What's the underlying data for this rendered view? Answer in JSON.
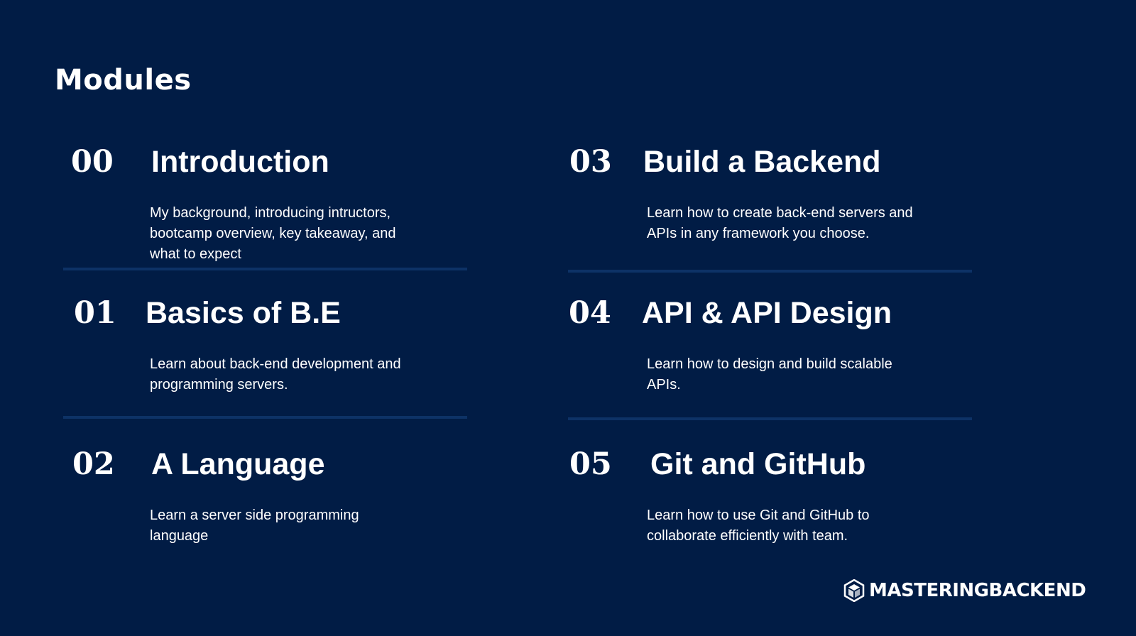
{
  "page": {
    "title": "Modules"
  },
  "modules": [
    {
      "number": "00",
      "title": "Introduction",
      "description": "My background, introducing intructors, bootcamp overview, key takeaway, and what to expect"
    },
    {
      "number": "01",
      "title": "Basics of B.E",
      "description": "Learn about back-end development and programming servers."
    },
    {
      "number": "02",
      "title": "A Language",
      "description": "Learn a server side programming language"
    },
    {
      "number": "03",
      "title": "Build a Backend",
      "description": "Learn how to create back-end servers and APIs in any framework you choose."
    },
    {
      "number": "04",
      "title": "API & API Design",
      "description": "Learn how to design and build scalable APIs."
    },
    {
      "number": "05",
      "title": "Git and GitHub",
      "description": "Learn how to use Git and GitHub to collaborate efficiently with team."
    }
  ],
  "brand": {
    "name": "MASTERINGBACKEND",
    "icon": "hexagon-cube-icon"
  },
  "colors": {
    "background": "#011c45",
    "divider": "#0d3266",
    "text": "#ffffff"
  }
}
